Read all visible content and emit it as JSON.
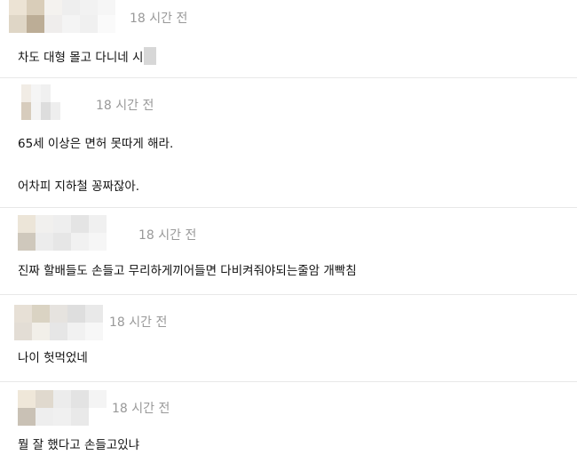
{
  "comments": [
    {
      "time": "18 시간 전",
      "lines": [
        "차도 대형 몰고 다니네 시"
      ],
      "redacted_suffix": true,
      "avatar": [
        "#ece3d4",
        "#d9cdb9",
        "#f4f2ef",
        "#eeeeee",
        "#f2f2f2",
        "#f6f6f6",
        "#dfd6c6",
        "#bcad96",
        "#efedec",
        "#f4f4f4",
        "#f0f0f0",
        "#fafafa"
      ]
    },
    {
      "time": "18 시간 전",
      "lines": [
        "65세 이상은 면허 못따게 해라.",
        "어차피 지하철 꽁짜잖아."
      ],
      "avatar": [
        "#f1ece5",
        "#f5f5f5",
        "#f0f0f0",
        "#ffffff",
        "#ffffff",
        "#ffffff",
        "#d7ccbd",
        "#f4f4f4",
        "#dddddd",
        "#eeeeee",
        "#ffffff",
        "#ffffff"
      ]
    },
    {
      "time": "18 시간 전",
      "lines": [
        "진짜 할배들도 손들고 무리하게끼어들면 다비켜줘야되는줄암 개빡침"
      ],
      "avatar": [
        "#ece5d8",
        "#f1f0ee",
        "#eeeeee",
        "#e4e4e4",
        "#f0f0f0",
        "#ffffff",
        "#cfc8bc",
        "#ececec",
        "#e6e6e6",
        "#f1f1f1",
        "#f6f6f6",
        "#ffffff"
      ]
    },
    {
      "time": "18 시간 전",
      "lines": [
        "나이 헛먹었네"
      ],
      "avatar": [
        "#e7e0d6",
        "#dad3c3",
        "#e6e3df",
        "#dedede",
        "#e9e9e9",
        "#ffffff",
        "#e3ddd5",
        "#f2efe9",
        "#e6e6e6",
        "#f1f1f1",
        "#f7f7f7",
        "#ffffff"
      ]
    },
    {
      "time": "18 시간 전",
      "lines": [
        "뭘 잘 했다고 손들고있냐"
      ],
      "avatar": [
        "#efe7d9",
        "#e0d9ce",
        "#ececec",
        "#e3e3e3",
        "#f4f4f4",
        "#ffffff",
        "#c9c1b5",
        "#eeeeee",
        "#f0f0f0",
        "#e9e9e9",
        "#ffffff",
        "#ffffff"
      ]
    }
  ]
}
